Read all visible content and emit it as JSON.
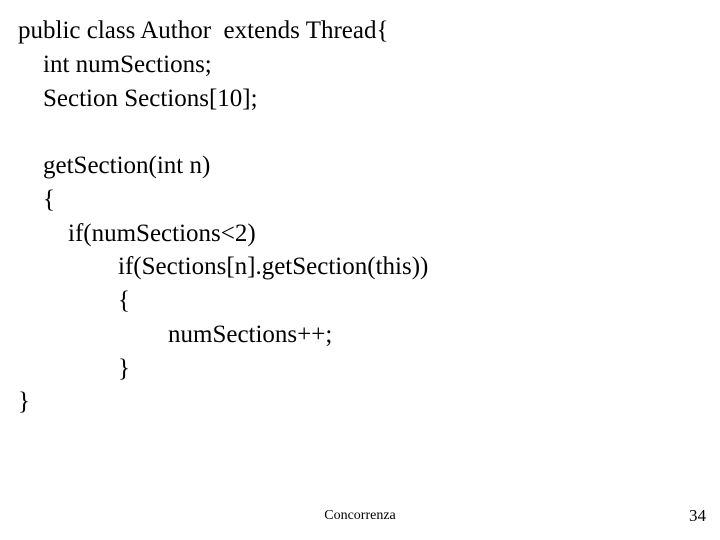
{
  "code": {
    "l1": "public class Author  extends Thread{",
    "l2": "    int numSections;",
    "l3": "    Section Sections[10];",
    "l4": "",
    "l5": "    getSection(int n)",
    "l6": "    {",
    "l7": "        if(numSections<2)",
    "l8": "                if(Sections[n].getSection(this))",
    "l9": "                {",
    "l10": "                        numSections++;",
    "l11": "                }",
    "l12": "}"
  },
  "footer_center": "Concorrenza",
  "footer_right": "34"
}
